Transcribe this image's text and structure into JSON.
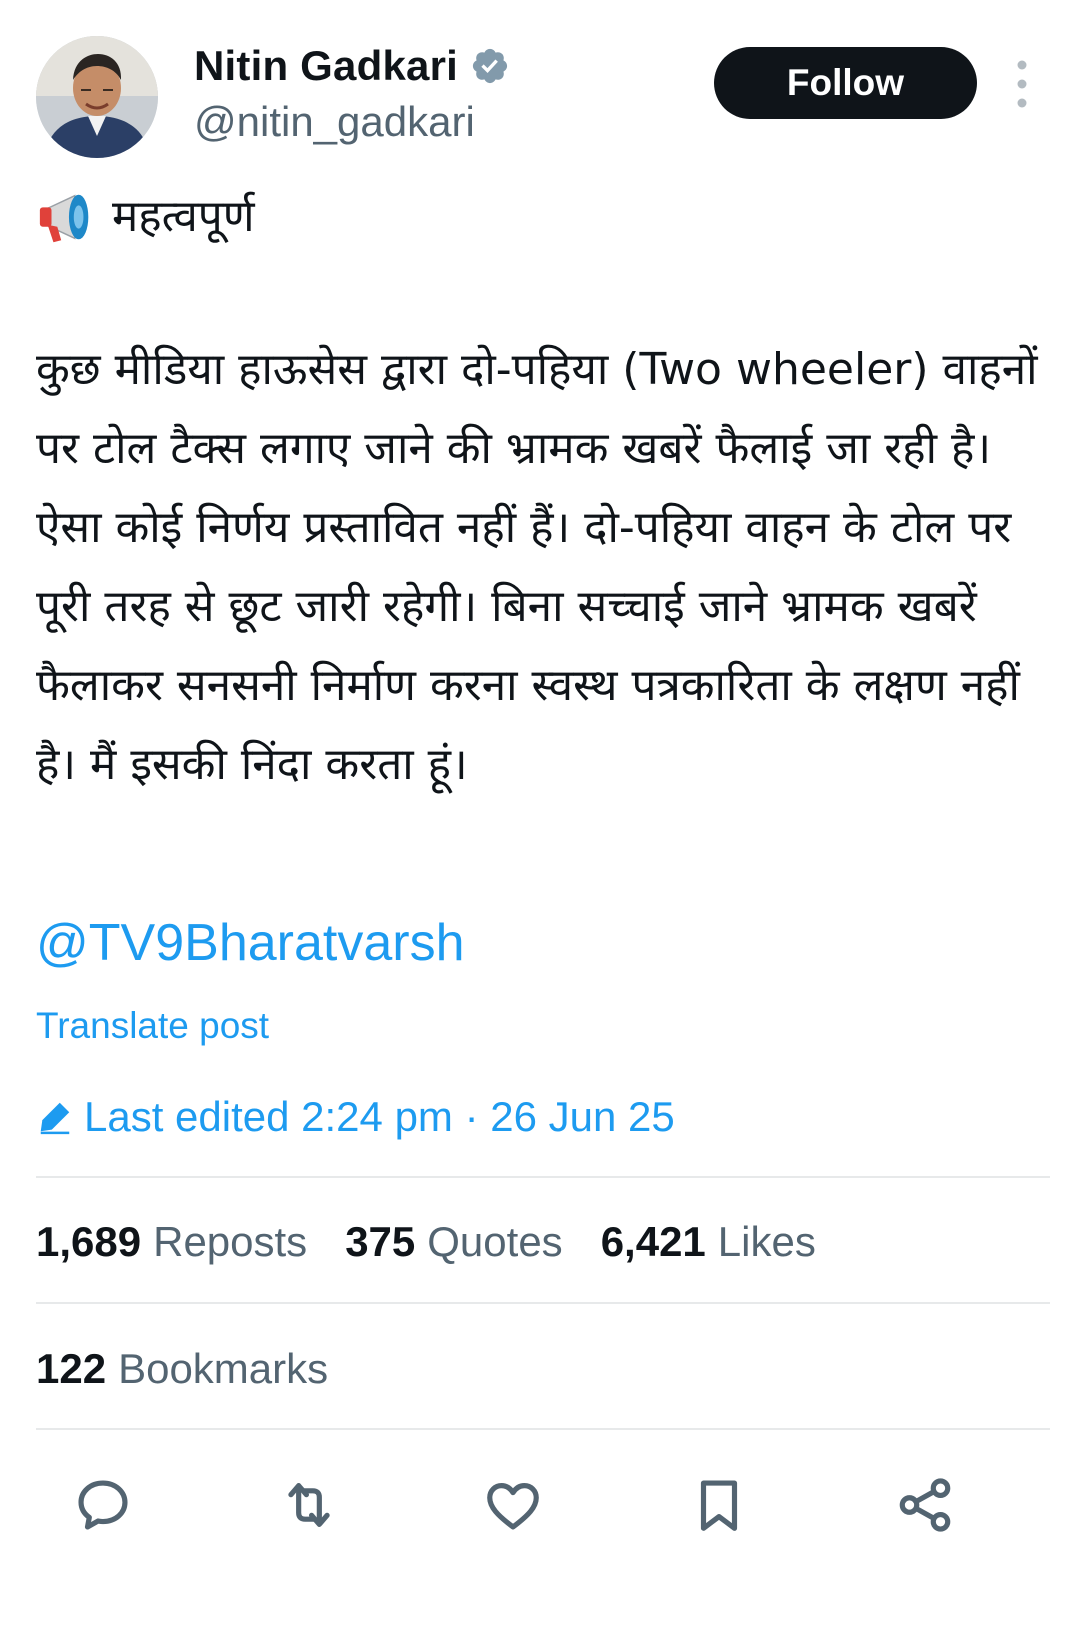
{
  "author": {
    "name": "Nitin Gadkari",
    "handle": "@nitin_gadkari",
    "verified_icon": "verified-badge-icon",
    "avatar_icon": "avatar"
  },
  "header": {
    "follow_label": "Follow",
    "more_icon": "more-vertical-icon"
  },
  "post": {
    "headline_icon": "megaphone-icon",
    "headline": "महत्वपूर्ण",
    "body": "कुछ मीडिया हाऊसेस  द्वारा दो-पहिया (Two wheeler) वाहनों पर टोल टैक्स लगाए जाने की भ्रामक खबरें फैलाई जा रही है। ऐसा कोई निर्णय प्रस्तावित नहीं हैं। दो-पहिया वाहन के टोल पर पूरी तरह से छूट जारी रहेगी। बिना सच्चाई जाने भ्रामक खबरें फैलाकर सनसनी निर्माण करना स्वस्थ पत्रकारिता के लक्षण नहीं है। मैं इसकी निंदा करता हूं।",
    "mention": "@TV9Bharatvarsh",
    "translate_label": "Translate post",
    "edited_label": "Last edited 2:24 pm · 26 Jun 25"
  },
  "stats": {
    "reposts_count": "1,689",
    "reposts_label": "Reposts",
    "quotes_count": "375",
    "quotes_label": "Quotes",
    "likes_count": "6,421",
    "likes_label": "Likes",
    "bookmarks_count": "122",
    "bookmarks_label": "Bookmarks"
  },
  "actions": [
    "reply-icon",
    "repost-icon",
    "like-icon",
    "bookmark-icon",
    "share-icon"
  ],
  "colors": {
    "accent": "#1d9bf0",
    "text": "#0f1419",
    "muted": "#536471",
    "divider": "#e7e9ea",
    "button_bg": "#0f1419"
  }
}
